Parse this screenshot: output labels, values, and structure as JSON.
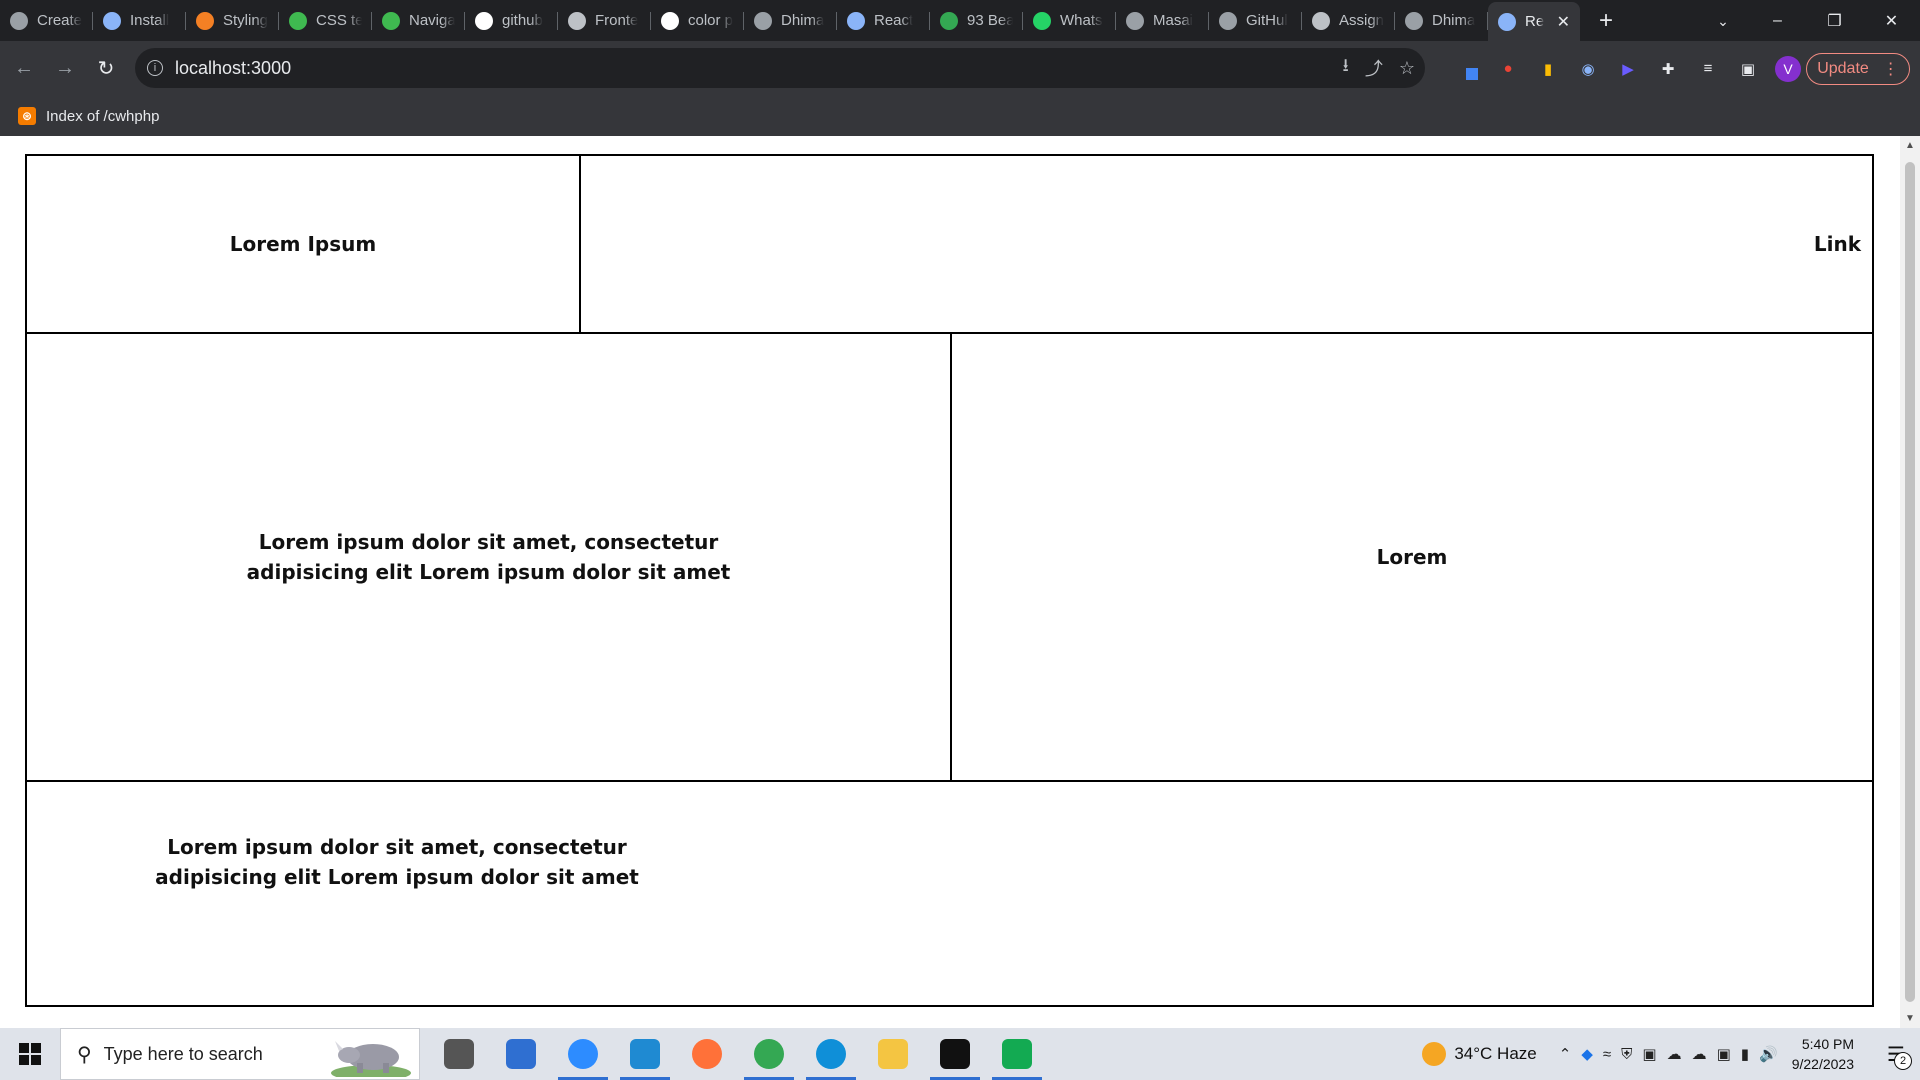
{
  "browser": {
    "tabs": [
      {
        "title": "Create",
        "icon": "openai-icon",
        "color": "#9aa0a6"
      },
      {
        "title": "Install",
        "icon": "bolt-icon",
        "color": "#8ab4f8"
      },
      {
        "title": "Styling",
        "icon": "stack-icon",
        "color": "#f48024"
      },
      {
        "title": "CSS te",
        "icon": "w-icon",
        "color": "#3fb950"
      },
      {
        "title": "Naviga",
        "icon": "nav-icon",
        "color": "#3fb950"
      },
      {
        "title": "github",
        "icon": "google-icon",
        "color": "#ffffff"
      },
      {
        "title": "Fronte",
        "icon": "square-icon",
        "color": "#bdc1c6"
      },
      {
        "title": "color p",
        "icon": "google-icon",
        "color": "#ffffff"
      },
      {
        "title": "Dhima",
        "icon": "github-icon",
        "color": "#9aa0a6"
      },
      {
        "title": "React",
        "icon": "react-icon",
        "color": "#8ab4f8"
      },
      {
        "title": "93 Bea",
        "icon": "gallery-icon",
        "color": "#34a853"
      },
      {
        "title": "Whats",
        "icon": "whatsapp-icon",
        "color": "#25d366"
      },
      {
        "title": "Masai",
        "icon": "masai-icon",
        "color": "#9aa0a6"
      },
      {
        "title": "GitHul",
        "icon": "github-icon",
        "color": "#9aa0a6"
      },
      {
        "title": "Assign",
        "icon": "square-icon",
        "color": "#bdc1c6"
      },
      {
        "title": "Dhima",
        "icon": "github-icon",
        "color": "#9aa0a6"
      }
    ],
    "active_tab": {
      "title": "Re",
      "icon": "react-icon",
      "color": "#8ab4f8"
    },
    "url": "localhost:3000",
    "update_label": "Update",
    "avatar_letter": "V",
    "bookmark": {
      "label": "Index of /cwhphp",
      "icon": "xampp-icon",
      "color": "#f57c00"
    }
  },
  "page": {
    "header_left": "Lorem Ipsum",
    "header_link": "Link",
    "main_left": "Lorem ipsum dolor sit amet, consectetur adipisicing elit Lorem ipsum dolor sit amet",
    "main_right": "Lorem",
    "footer_text": "Lorem ipsum dolor sit amet, consectetur adipisicing elit Lorem ipsum dolor sit amet"
  },
  "taskbar": {
    "search_placeholder": "Type here to search",
    "weather": "34°C  Haze",
    "time": "5:40 PM",
    "date": "9/22/2023",
    "notification_count": "2",
    "apps": [
      {
        "name": "task-view-icon",
        "color": "#555555"
      },
      {
        "name": "mail-icon",
        "color": "#2f6fd1"
      },
      {
        "name": "zoom-icon",
        "color": "#2d8cff"
      },
      {
        "name": "vscode-icon",
        "color": "#1f8ad2"
      },
      {
        "name": "firefox-icon",
        "color": "#ff7139"
      },
      {
        "name": "chrome-icon",
        "color": "#34a853"
      },
      {
        "name": "edge-icon",
        "color": "#0f8fd8"
      },
      {
        "name": "file-explorer-icon",
        "color": "#f4c542"
      },
      {
        "name": "terminal-icon",
        "color": "#111111"
      },
      {
        "name": "mongodb-icon",
        "color": "#13aa52"
      }
    ]
  }
}
